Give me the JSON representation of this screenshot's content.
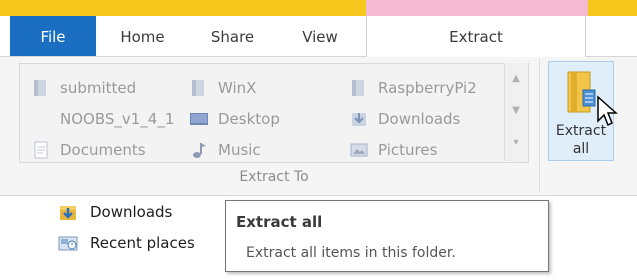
{
  "ribbon": {
    "tabs": {
      "file": "File",
      "home": "Home",
      "share": "Share",
      "view": "View",
      "extract": "Extract"
    },
    "extract_to": {
      "group_label": "Extract To",
      "items": [
        {
          "label": "submitted",
          "icon": "folder-zip-icon"
        },
        {
          "label": "NOOBS_v1_4_1",
          "icon": "blank-icon"
        },
        {
          "label": "Documents",
          "icon": "document-icon"
        },
        {
          "label": "WinX",
          "icon": "folder-zip-icon"
        },
        {
          "label": "Desktop",
          "icon": "desktop-icon"
        },
        {
          "label": "Music",
          "icon": "music-icon"
        },
        {
          "label": "RaspberryPi2",
          "icon": "folder-zip-icon"
        },
        {
          "label": "Downloads",
          "icon": "downloads-icon"
        },
        {
          "label": "Pictures",
          "icon": "pictures-icon"
        }
      ]
    },
    "extract_all": {
      "label_line1": "Extract",
      "label_line2": "all"
    }
  },
  "navigation": {
    "items": [
      {
        "label": "Downloads",
        "icon": "downloads-icon"
      },
      {
        "label": "Recent places",
        "icon": "recent-places-icon"
      }
    ]
  },
  "tooltip": {
    "title": "Extract all",
    "description": "Extract all items in this folder."
  },
  "colors": {
    "file_tab": "#1b6fc2",
    "title_strip": "#f6c81d",
    "context_header": "#f6b9d2",
    "extract_all_highlight": "#dfeef9"
  }
}
